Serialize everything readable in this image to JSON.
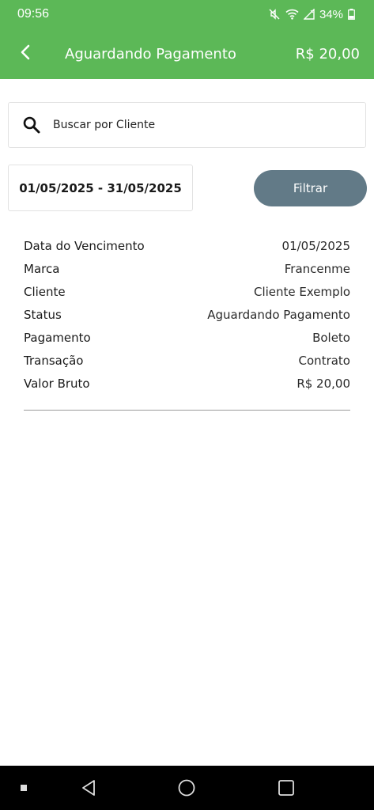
{
  "status_bar": {
    "time": "09:56",
    "battery": "34%"
  },
  "app_bar": {
    "title": "Aguardando Pagamento",
    "amount": "R$ 20,00"
  },
  "search": {
    "placeholder": "Buscar por Cliente",
    "value": ""
  },
  "filter": {
    "date_range": "01/05/2025 - 31/05/2025",
    "button_label": "Filtrar"
  },
  "details": [
    {
      "label": "Data do Vencimento",
      "value": "01/05/2025"
    },
    {
      "label": "Marca",
      "value": "Francenme"
    },
    {
      "label": "Cliente",
      "value": "Cliente Exemplo"
    },
    {
      "label": "Status",
      "value": "Aguardando Pagamento"
    },
    {
      "label": "Pagamento",
      "value": "Boleto"
    },
    {
      "label": "Transação",
      "value": "Contrato"
    },
    {
      "label": "Valor Bruto",
      "value": "R$ 20,00"
    }
  ],
  "colors": {
    "primary": "#5cb857",
    "filter_button": "#627a87"
  },
  "icons": {
    "back": "back-arrow-icon",
    "search": "search-icon",
    "nav_back": "nav-back-icon",
    "nav_home": "nav-home-icon",
    "nav_recents": "nav-recents-icon"
  }
}
